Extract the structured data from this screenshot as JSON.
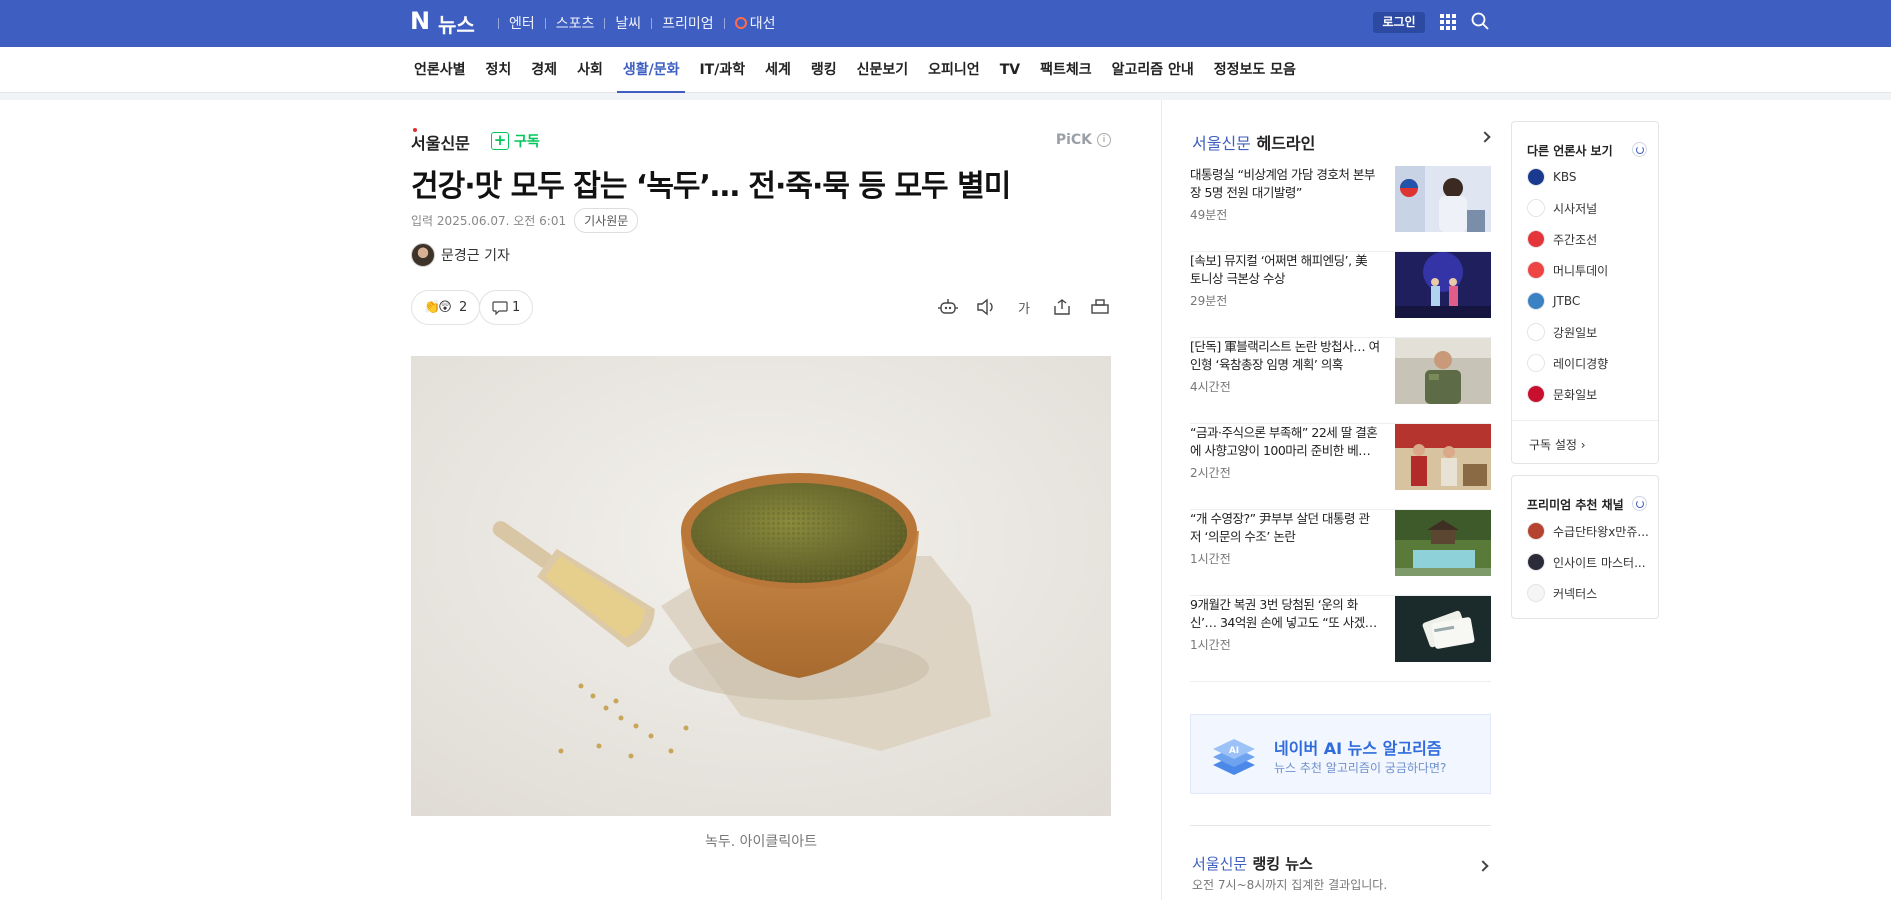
{
  "topbar": {
    "logo": "N",
    "service": "뉴스",
    "nav": [
      "엔터",
      "스포츠",
      "날씨",
      "프리미엄",
      "대선"
    ],
    "login": "로그인"
  },
  "categories": [
    "언론사별",
    "정치",
    "경제",
    "사회",
    "생활/문화",
    "IT/과학",
    "세계",
    "랭킹",
    "신문보기",
    "오피니언",
    "TV",
    "팩트체크",
    "알고리즘 안내",
    "정정보도 모음"
  ],
  "active_category": "생활/문화",
  "article": {
    "press": "서울신문",
    "subscribe": "구독",
    "pick": "PiCK",
    "headline": "건강·맛 모두 잡는 ‘녹두’… 전·죽·묵 등 모두 별미",
    "input_label": "입력",
    "date": "2025.06.07. 오전 6:01",
    "original_button": "기사원문",
    "reporter": "문경근 기자",
    "like_count": "2",
    "comment_count": "1",
    "font_tool": "가",
    "caption": "녹두. 아이클릭아트"
  },
  "headlines": {
    "press": "서울신문",
    "title": "헤드라인",
    "items": [
      {
        "text": "대통령실 “비상계엄 가담 경호처 본부장 5명 전원 대기발령”",
        "count": "49분전"
      },
      {
        "text": "[속보] 뮤지컬 ‘어쩌면 해피엔딩’, 美 토니상 극본상 수상",
        "count": "29분전"
      },
      {
        "text": "[단독] 軍블랙리스트 논란 방첩사… 여인형 ‘육참총장 임명 계획’ 의혹",
        "count": "4시간전"
      },
      {
        "text": "“금과·주식으론 부족해” 22세 딸 결혼에 사향고양이 100마리 준비한 베…",
        "count": "2시간전"
      },
      {
        "text": "“개 수영장?” 尹부부 살던 대통령 관저 ‘의문의 수조’ 논란",
        "count": "1시간전"
      },
      {
        "text": "9개월간 복권 3번 당첨된 ‘운의 화신’… 34억원 손에 넣고도 “또 사겠다”",
        "count": "1시간전"
      }
    ]
  },
  "ai_banner": {
    "title": "네이버 AI 뉴스 알고리즘",
    "subtitle": "뉴스 추천 알고리즘이 궁금하다면?",
    "badge": "AI"
  },
  "ranking": {
    "press": "서울신문",
    "title": "랭킹 뉴스",
    "subtitle": "오전 7시~8시까지 집계한 결과입니다."
  },
  "other_press": {
    "title": "다른 언론사 보기",
    "items": [
      {
        "name": "KBS",
        "color": "#1a3a8f"
      },
      {
        "name": "시사저널",
        "color": "#ffffff"
      },
      {
        "name": "주간조선",
        "color": "#e4353b"
      },
      {
        "name": "머니투데이",
        "color": "#ef4444"
      },
      {
        "name": "JTBC",
        "color": "#3b82c4"
      },
      {
        "name": "강원일보",
        "color": "#ffffff"
      },
      {
        "name": "레이디경향",
        "color": "#ffffff"
      },
      {
        "name": "문화일보",
        "color": "#c8102e"
      }
    ],
    "setting": "구독 설정"
  },
  "premium": {
    "title": "프리미엄 추천 채널",
    "items": [
      {
        "name": "수급단타왕x만쥬...",
        "color": "#b5432f"
      },
      {
        "name": "인사이트 마스터...",
        "color": "#2b2b3a"
      },
      {
        "name": "커넥터스",
        "color": "#f5f5f5"
      }
    ]
  }
}
